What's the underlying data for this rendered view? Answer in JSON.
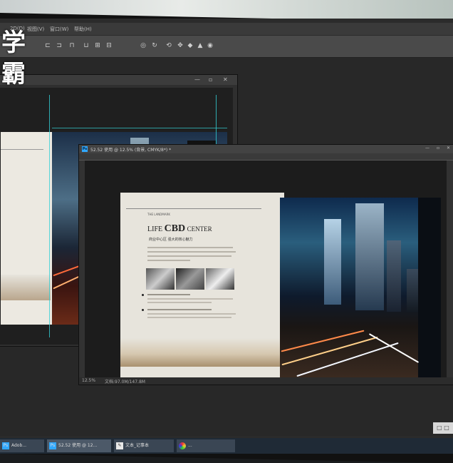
{
  "watermark": "学霸",
  "menubar": {
    "items": [
      "2D(D)",
      "视图(V)",
      "窗口(W)",
      "帮助(H)"
    ]
  },
  "window2": {
    "title": "52.52 使用 @ 12.5% (背景, CMYK/8*) *",
    "zoom": "12.5%",
    "doc_status": "文档:97.0M/147.8M"
  },
  "brochure": {
    "kicker": "THE LANDMARK",
    "title_left": "LIFE",
    "title_main": "CBD",
    "title_right": "CENTER",
    "subtitle": "商业中心区  强大的核心魅力"
  },
  "taskbar": {
    "items": [
      "Adob...",
      "52.52 使用 @ 12...",
      "文本_记事本",
      "..."
    ]
  },
  "corner_badge": "□ □",
  "colors": {
    "accent_guide": "#33d0d6",
    "ps_blue": "#31a8ff"
  }
}
